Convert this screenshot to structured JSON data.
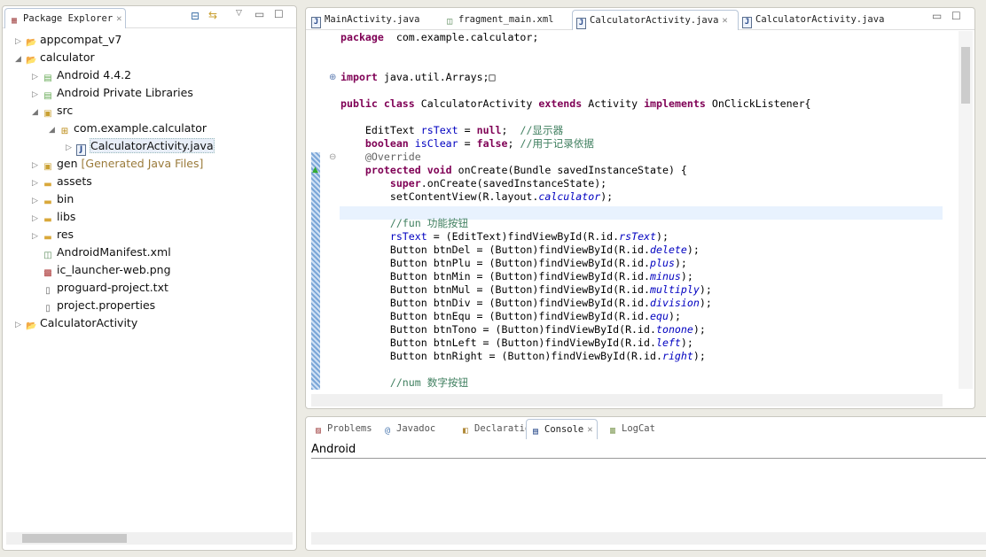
{
  "package_explorer": {
    "title": "Package Explorer",
    "tree": [
      {
        "label": "appcompat_v7",
        "level": 0,
        "twisty": "▷",
        "icon": "project-icon"
      },
      {
        "label": "calculator",
        "level": 0,
        "twisty": "◢",
        "icon": "project-icon"
      },
      {
        "label": "Android 4.4.2",
        "level": 1,
        "twisty": "▷",
        "icon": "library-icon"
      },
      {
        "label": "Android Private Libraries",
        "level": 1,
        "twisty": "▷",
        "icon": "library-icon"
      },
      {
        "label": "src",
        "level": 1,
        "twisty": "◢",
        "icon": "source-folder-icon"
      },
      {
        "label": "com.example.calculator",
        "level": 2,
        "twisty": "◢",
        "icon": "package-icon"
      },
      {
        "label": "CalculatorActivity.java",
        "level": 3,
        "twisty": "▷",
        "icon": "java-file-icon",
        "selected": true
      },
      {
        "label": "gen",
        "decoration": "[Generated Java Files]",
        "level": 1,
        "twisty": "▷",
        "icon": "source-folder-icon"
      },
      {
        "label": "assets",
        "level": 1,
        "twisty": "▷",
        "icon": "folder-icon"
      },
      {
        "label": "bin",
        "level": 1,
        "twisty": "▷",
        "icon": "folder-icon"
      },
      {
        "label": "libs",
        "level": 1,
        "twisty": "▷",
        "icon": "folder-icon"
      },
      {
        "label": "res",
        "level": 1,
        "twisty": "▷",
        "icon": "folder-icon"
      },
      {
        "label": "AndroidManifest.xml",
        "level": 1,
        "twisty": "",
        "icon": "xml-file-icon"
      },
      {
        "label": "ic_launcher-web.png",
        "level": 1,
        "twisty": "",
        "icon": "image-file-icon"
      },
      {
        "label": "proguard-project.txt",
        "level": 1,
        "twisty": "",
        "icon": "text-file-icon"
      },
      {
        "label": "project.properties",
        "level": 1,
        "twisty": "",
        "icon": "text-file-icon"
      },
      {
        "label": "CalculatorActivity",
        "level": 0,
        "twisty": "▷",
        "icon": "project-icon"
      }
    ]
  },
  "editor": {
    "tabs": [
      {
        "label": "MainActivity.java",
        "icon": "java-file-icon"
      },
      {
        "label": "fragment_main.xml",
        "icon": "xml-file-icon"
      },
      {
        "label": "CalculatorActivity.java",
        "icon": "java-file-icon",
        "active": true
      },
      {
        "label": "CalculatorActivity.java",
        "icon": "java-file-icon"
      }
    ],
    "lines": [
      [
        [
          "kw",
          "package"
        ],
        [
          "",
          "  com.example.calculator;"
        ]
      ],
      [],
      [],
      [
        [
          "kw",
          "import"
        ],
        [
          "",
          " java.util.Arrays;"
        ],
        [
          "",
          "□"
        ]
      ],
      [],
      [
        [
          "kw",
          "public class"
        ],
        [
          "",
          " CalculatorActivity "
        ],
        [
          "kw",
          "extends"
        ],
        [
          "",
          " Activity "
        ],
        [
          "kw",
          "implements"
        ],
        [
          "",
          " OnClickListener{"
        ]
      ],
      [],
      [
        [
          "",
          "    EditText "
        ],
        [
          "fld",
          "rsText"
        ],
        [
          "",
          " = "
        ],
        [
          "kw",
          "null"
        ],
        [
          "",
          ";  "
        ],
        [
          "cmt",
          "//显示器"
        ]
      ],
      [
        [
          "",
          "    "
        ],
        [
          "kw",
          "boolean"
        ],
        [
          "",
          " "
        ],
        [
          "fld",
          "isClear"
        ],
        [
          "",
          " = "
        ],
        [
          "kw",
          "false"
        ],
        [
          "",
          "; "
        ],
        [
          "cmt",
          "//用于记录依据"
        ]
      ],
      [
        [
          "ann",
          "    @Override"
        ]
      ],
      [
        [
          "",
          "    "
        ],
        [
          "kw",
          "protected void"
        ],
        [
          "",
          " onCreate(Bundle savedInstanceState) {"
        ]
      ],
      [
        [
          "",
          "        "
        ],
        [
          "kw",
          "super"
        ],
        [
          "",
          ".onCreate(savedInstanceState);"
        ]
      ],
      [
        [
          "",
          "        setContentView(R.layout."
        ],
        [
          "it",
          "calculator"
        ],
        [
          "",
          ");"
        ]
      ],
      [],
      [
        [
          "cmt",
          "        //fun 功能按钮"
        ]
      ],
      [
        [
          "",
          "        "
        ],
        [
          "fld",
          "rsText"
        ],
        [
          "",
          " = (EditText)findViewById(R.id."
        ],
        [
          "it",
          "rsText"
        ],
        [
          "",
          ");"
        ]
      ],
      [
        [
          "",
          "        Button btnDel = (Button)findViewById(R.id."
        ],
        [
          "it",
          "delete"
        ],
        [
          "",
          ");"
        ]
      ],
      [
        [
          "",
          "        Button btnPlu = (Button)findViewById(R.id."
        ],
        [
          "it",
          "plus"
        ],
        [
          "",
          ");"
        ]
      ],
      [
        [
          "",
          "        Button btnMin = (Button)findViewById(R.id."
        ],
        [
          "it",
          "minus"
        ],
        [
          "",
          ");"
        ]
      ],
      [
        [
          "",
          "        Button btnMul = (Button)findViewById(R.id."
        ],
        [
          "it",
          "multiply"
        ],
        [
          "",
          ");"
        ]
      ],
      [
        [
          "",
          "        Button btnDiv = (Button)findViewById(R.id."
        ],
        [
          "it",
          "division"
        ],
        [
          "",
          ");"
        ]
      ],
      [
        [
          "",
          "        Button btnEqu = (Button)findViewById(R.id."
        ],
        [
          "it",
          "equ"
        ],
        [
          "",
          ");"
        ]
      ],
      [
        [
          "",
          "        Button btnTono = (Button)findViewById(R.id."
        ],
        [
          "it",
          "tonone"
        ],
        [
          "",
          ");"
        ]
      ],
      [
        [
          "",
          "        Button btnLeft = (Button)findViewById(R.id."
        ],
        [
          "it",
          "left"
        ],
        [
          "",
          ");"
        ]
      ],
      [
        [
          "",
          "        Button btnRight = (Button)findViewById(R.id."
        ],
        [
          "it",
          "right"
        ],
        [
          "",
          ");"
        ]
      ],
      [],
      [
        [
          "cmt",
          "        //num 数字按钮"
        ]
      ]
    ]
  },
  "bottom": {
    "tabs": [
      {
        "label": "Problems",
        "icon": "problems-icon"
      },
      {
        "label": "Javadoc",
        "icon": "at-icon"
      },
      {
        "label": "Declaration",
        "icon": "declaration-icon"
      },
      {
        "label": "Console",
        "icon": "console-icon",
        "active": true
      },
      {
        "label": "LogCat",
        "icon": "logcat-icon"
      }
    ],
    "console_title": "Android"
  }
}
